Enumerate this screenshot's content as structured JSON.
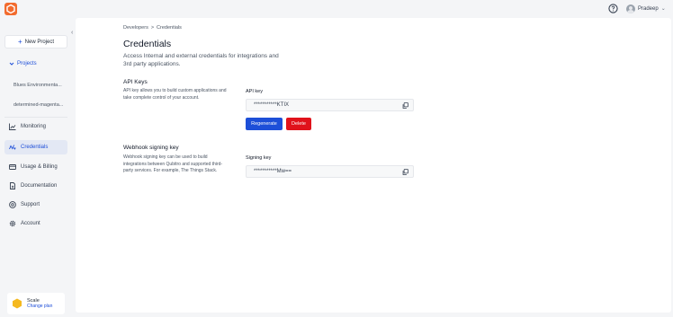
{
  "topbar": {
    "logo_icon": "hexagon-logo-icon",
    "help_icon": "help-circle-icon",
    "user_name": "Pradeep",
    "user_menu_icon": "chevron-down-icon"
  },
  "sidebar": {
    "collapse_glyph": "‹",
    "new_project_label": "New Project",
    "projects_label": "Projects",
    "projects": [
      "Blues Environmenta...",
      "determined-magenta..."
    ],
    "nav": [
      {
        "label": "Monitoring",
        "icon": "chart-icon",
        "active": false
      },
      {
        "label": "Credentials",
        "icon": "key-icon",
        "active": true
      },
      {
        "label": "Usage & Billing",
        "icon": "card-icon",
        "active": false
      },
      {
        "label": "Documentation",
        "icon": "document-icon",
        "active": false
      },
      {
        "label": "Support",
        "icon": "support-icon",
        "active": false
      },
      {
        "label": "Account",
        "icon": "gear-icon",
        "active": false
      }
    ],
    "plan": {
      "name": "Scale",
      "link": "Change plan"
    }
  },
  "main": {
    "breadcrumb": [
      "Developers",
      ">",
      "Credentials"
    ],
    "title": "Credentials",
    "description": "Access Internal and external credentials for integrations and 3rd party applications.",
    "api_keys": {
      "title": "API Keys",
      "description": "API key allows you to build custom applications and take complete control of your account.",
      "field_label": "API key",
      "value": "***********KTIX",
      "regenerate_label": "Regenerate",
      "delete_label": "Delete"
    },
    "webhook": {
      "title": "Webhook signing key",
      "description": "Webhook signing key can be used to build integrations between Qubitro and supported third-party services. For example, The Things Stack.",
      "field_label": "Signing key",
      "value": "***********Mw=="
    }
  },
  "colors": {
    "accent": "#1d4fd8",
    "danger": "#e0121b",
    "logo": "#f26b2e",
    "plan_badge": "#f5b920",
    "active_nav_bg": "#e3e8f4"
  }
}
